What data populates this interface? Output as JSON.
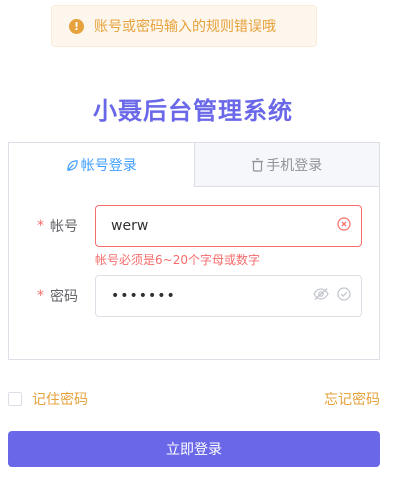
{
  "toast": {
    "message": "账号或密码输入的规则错误哦",
    "icon": "warning-icon"
  },
  "title": "小聂后台管理系统",
  "tabs": [
    {
      "label": "帐号登录",
      "icon": "leaf-icon",
      "active": true
    },
    {
      "label": "手机登录",
      "icon": "phone-icon",
      "active": false
    }
  ],
  "form": {
    "account": {
      "label": "帐号",
      "value": "werw",
      "error": "帐号必须是6~20个字母或数字"
    },
    "password": {
      "label": "密码",
      "value": "•••••••"
    }
  },
  "remember_label": "记住密码",
  "forgot_label": "忘记密码",
  "login_label": "立即登录",
  "colors": {
    "brand": "#6a68e8",
    "warning": "#e6a23c",
    "danger": "#f56c6c",
    "tab_active": "#409eff"
  }
}
